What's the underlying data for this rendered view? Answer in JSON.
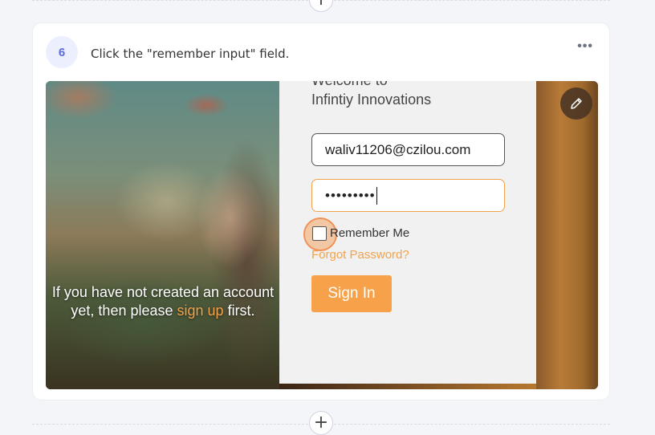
{
  "step": {
    "number": "6",
    "instruction": "Click the \"remember input\" field.",
    "more_icon": "•••"
  },
  "add_icon": "+",
  "screenshot": {
    "art_text": {
      "before": "If you have not created an account yet, then please ",
      "link": "sign up",
      "after": " first."
    },
    "login": {
      "welcome_line1": "Welcome to",
      "welcome_line2": "Infintiy Innovations",
      "email_value": "waliv11206@czilou.com",
      "password_value": "•••••••••",
      "remember_label": "Remember Me",
      "forgot_label": "Forgot Password?",
      "signin_label": "Sign In"
    },
    "accent_color": "#f7a14a"
  }
}
